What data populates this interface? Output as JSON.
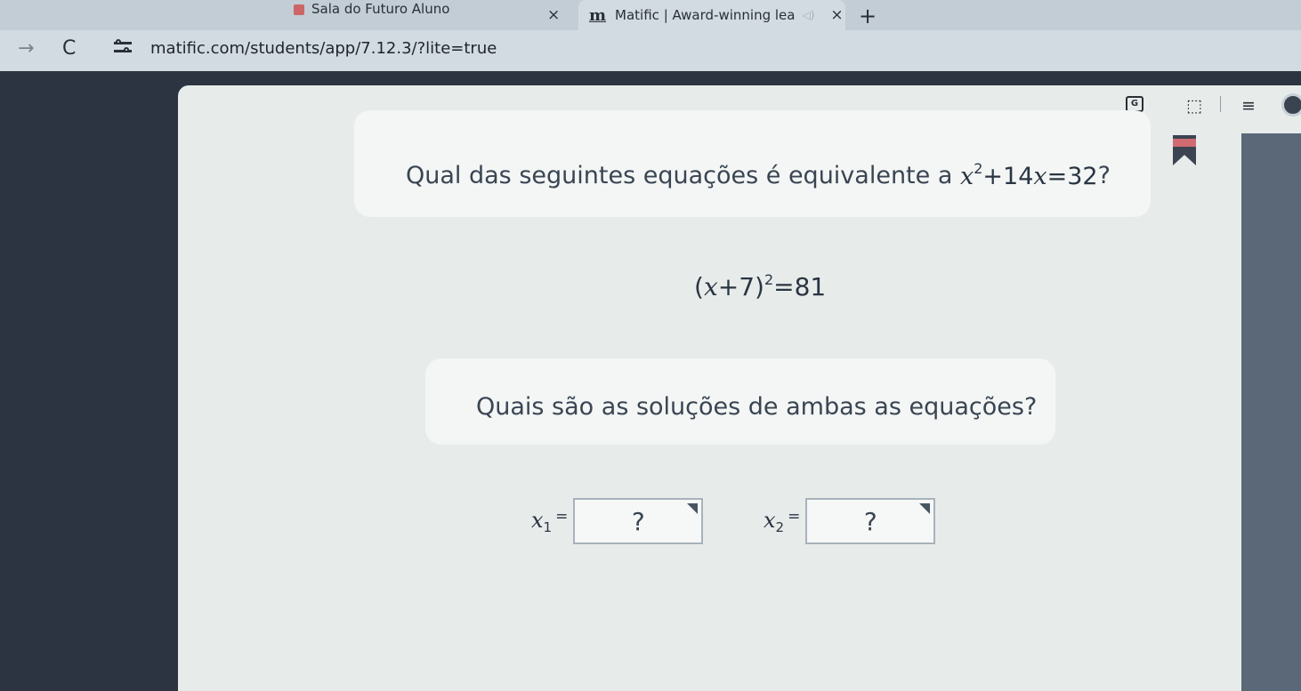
{
  "browser": {
    "tabs": [
      {
        "title": "Sala do Futuro Aluno",
        "close": "×"
      },
      {
        "favicon": "m",
        "title": "Matific | Award-winning lea",
        "audio": "◁)",
        "close": "×"
      }
    ],
    "new_tab": "+",
    "nav": {
      "forward": "→",
      "reload": "C"
    },
    "url": "matific.com/students/app/7.12.3/?lite=true",
    "toolbar": {
      "translate": "G",
      "bookmark": "⬚",
      "reading": "≡"
    }
  },
  "question": {
    "prefix": "Qual das seguintes equações é equivalente a ",
    "expr": {
      "x1": "x",
      "exp1": "2",
      "mid": "+14",
      "x2": "x",
      "rhs": "=32"
    },
    "suffix": "?"
  },
  "equation": {
    "open": "(",
    "x": "x",
    "mid": "+7)",
    "exp": "2",
    "rhs": "=81"
  },
  "prompt": "Quais são as soluções de ambas as equações?",
  "answers": [
    {
      "var": "x",
      "sub": "1",
      "eq": "=",
      "placeholder": "?"
    },
    {
      "var": "x",
      "sub": "2",
      "eq": "=",
      "placeholder": "?"
    }
  ]
}
